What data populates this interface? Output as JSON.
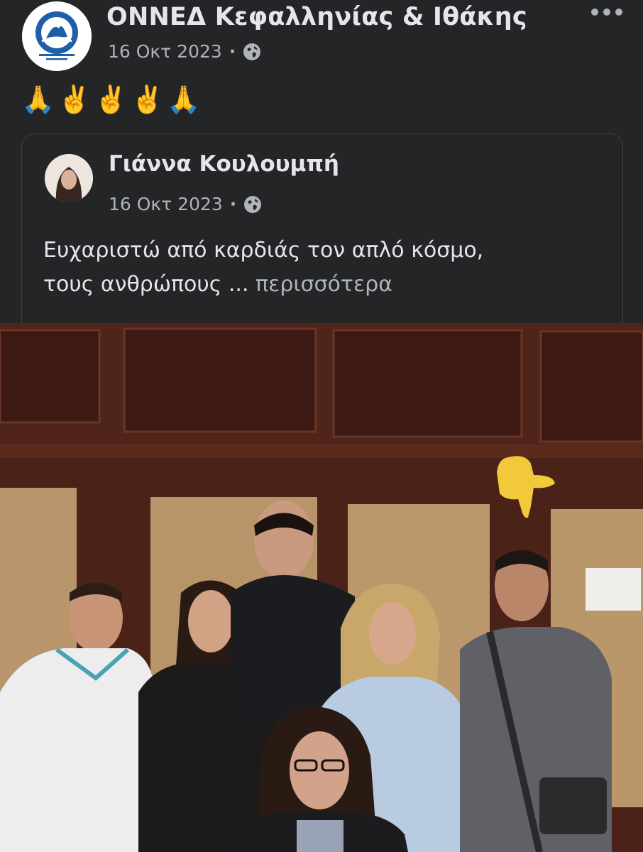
{
  "post": {
    "page_name": "ΟΝΝΕΔ Κεφαλληνίας & Ιθάκης",
    "date": "16 Οκτ 2023",
    "separator": "·",
    "privacy_icon": "globe-icon",
    "more_icon": "more-horizontal-icon",
    "emojis": "🙏✌️✌️✌️🙏"
  },
  "shared": {
    "author": "Γιάννα Κουλουμπή",
    "date": "16 Οκτ 2023",
    "separator": "·",
    "privacy_icon": "globe-icon",
    "text_line1": "Ευχαριστώ από καρδιάς τον απλό κόσμο,",
    "text_line2": "τους ανθρώπους ...",
    "see_more": "περισσότερα"
  },
  "colors": {
    "background": "#242526",
    "primary_text": "#e4e6eb",
    "secondary_text": "#b0b3b8",
    "card_border": "#3e4042",
    "logo_blue": "#1f5fa8"
  },
  "photo": {
    "description_icon": "pointing-down-hand-icon"
  }
}
